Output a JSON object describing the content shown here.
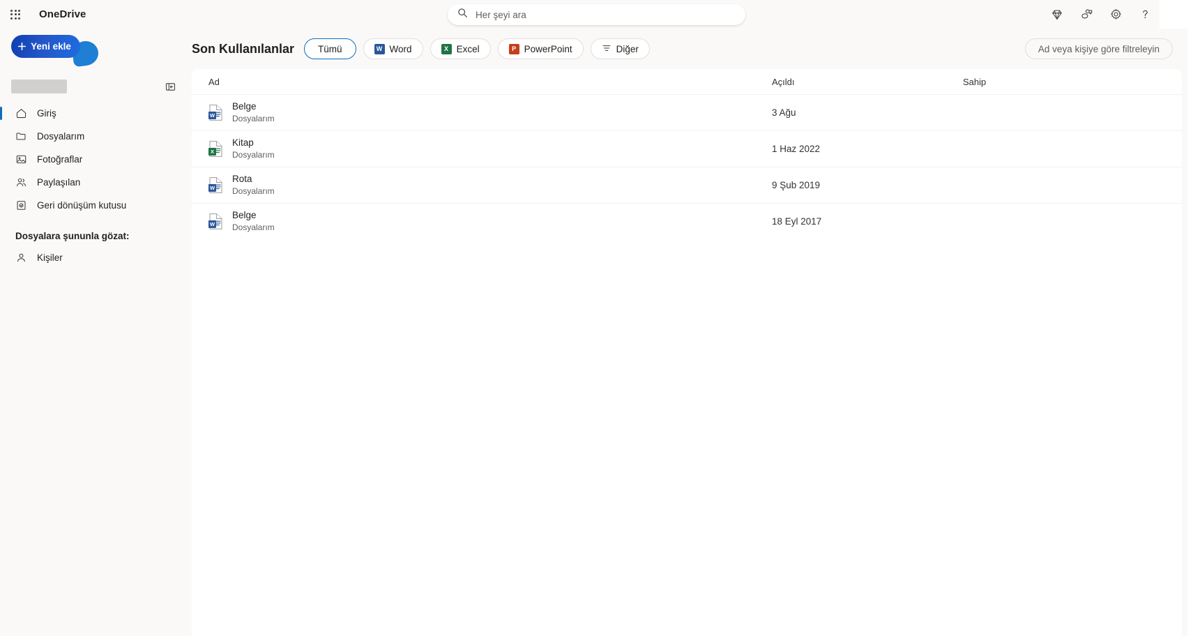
{
  "topbar": {
    "waffle_title": "app-launcher",
    "brand": "OneDrive",
    "search_placeholder": "Her şeyi ara",
    "search_value": "",
    "icons": [
      "premium-diamond-icon",
      "feedback-icon",
      "settings-gear-icon",
      "help-question-icon"
    ]
  },
  "sidebar": {
    "new_button": "Yeni ekle",
    "items": [
      {
        "label": "Giriş",
        "icon": "home-icon",
        "active": true
      },
      {
        "label": "Dosyalarım",
        "icon": "folder-icon",
        "active": false
      },
      {
        "label": "Fotoğraflar",
        "icon": "photo-icon",
        "active": false
      },
      {
        "label": "Paylaşılan",
        "icon": "people-icon",
        "active": false
      },
      {
        "label": "Geri dönüşüm kutusu",
        "icon": "recycle-bin-icon",
        "active": false
      }
    ],
    "browse_section_label": "Dosyalara şununla gözat:",
    "browse_items": [
      {
        "label": "Kişiler",
        "icon": "person-icon"
      }
    ]
  },
  "main": {
    "title": "Son Kullanılanlar",
    "chips": [
      {
        "label": "Tümü",
        "icon": "none",
        "selected": true
      },
      {
        "label": "Word",
        "icon": "word-icon",
        "selected": false
      },
      {
        "label": "Excel",
        "icon": "excel-icon",
        "selected": false
      },
      {
        "label": "PowerPoint",
        "icon": "powerpoint-icon",
        "selected": false
      },
      {
        "label": "Diğer",
        "icon": "filter-icon",
        "selected": false
      }
    ],
    "filter_button": "Ad veya kişiye göre filtreleyin",
    "table": {
      "columns": {
        "name": "Ad",
        "opened": "Açıldı",
        "owner": "Sahip"
      },
      "rows": [
        {
          "name": "Belge",
          "location": "Dosyalarım",
          "opened": "3 Ağu",
          "owner": "",
          "filetype": "word"
        },
        {
          "name": "Kitap",
          "location": "Dosyalarım",
          "opened": "1 Haz 2022",
          "owner": "",
          "filetype": "excel"
        },
        {
          "name": "Rota",
          "location": "Dosyalarım",
          "opened": "9 Şub 2019",
          "owner": "",
          "filetype": "word"
        },
        {
          "name": "Belge",
          "location": "Dosyalarım",
          "opened": "18 Eyl 2017",
          "owner": "",
          "filetype": "word"
        }
      ]
    }
  },
  "colors": {
    "accent": "#0f6cbd",
    "word": "#2b579a",
    "excel": "#217346",
    "powerpoint": "#c43e1c",
    "page_bg": "#faf9f8"
  }
}
